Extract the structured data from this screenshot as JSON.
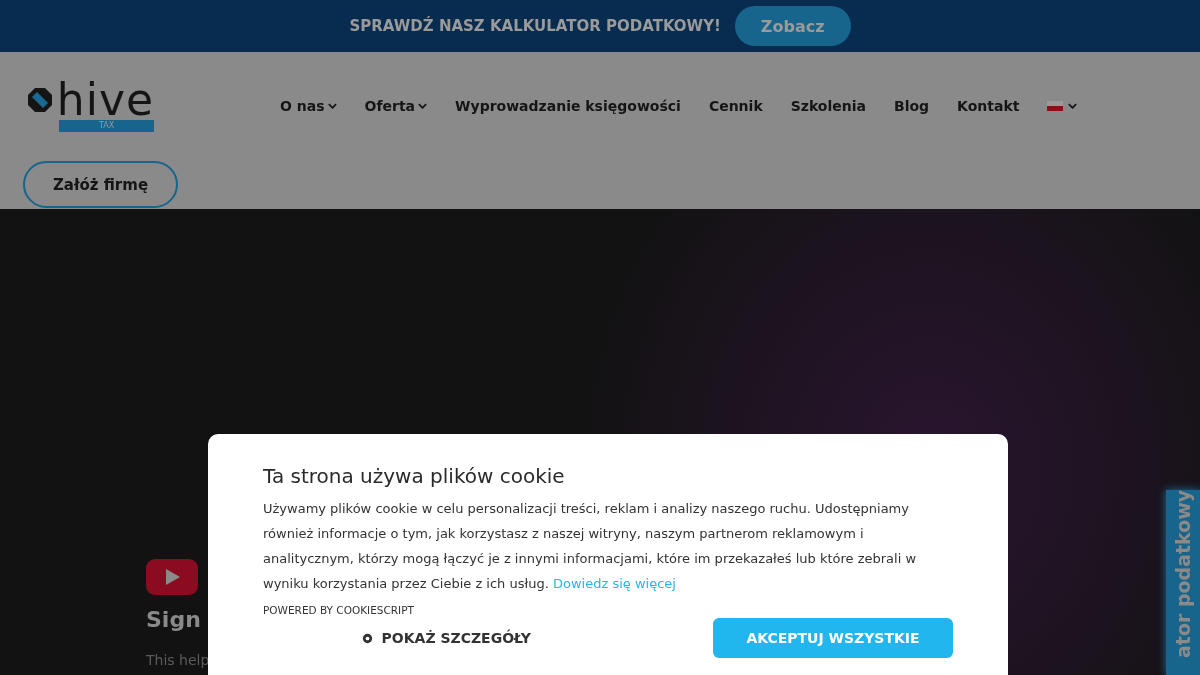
{
  "promo_bar": {
    "text": "SPRAWDŹ NASZ KALKULATOR PODATKOWY!",
    "button": "Zobacz"
  },
  "header": {
    "logo": {
      "name": "hive",
      "tag": "TAX"
    },
    "nav": [
      {
        "label": "O nas",
        "dropdown": true
      },
      {
        "label": "Oferta",
        "dropdown": true
      },
      {
        "label": "Wyprowadzanie księgowości",
        "dropdown": false
      },
      {
        "label": "Cennik",
        "dropdown": false
      },
      {
        "label": "Szkolenia",
        "dropdown": false
      },
      {
        "label": "Blog",
        "dropdown": false
      },
      {
        "label": "Kontakt",
        "dropdown": false
      }
    ],
    "cta": "Załóż firmę"
  },
  "video_embed": {
    "heading": "Sign",
    "text": "This help"
  },
  "side_tab": {
    "label": "ator podatkowy"
  },
  "cookie_modal": {
    "title": "Ta strona używa plików cookie",
    "body": "Używamy plików cookie w celu personalizacji treści, reklam i analizy naszego ruchu. Udostępniamy również informacje o tym, jak korzystasz z naszej witryny, naszym partnerom reklamowym i analitycznym, którzy mogą łączyć je z innymi informacjami, które im przekazałeś lub które zebrali w wyniku korzystania przez Ciebie z ich usług.",
    "link": "Dowiedz się więcej",
    "powered_by": "POWERED BY COOKIESCRIPT",
    "buttons": [
      {
        "label": "POKAŻ SZCZEGÓŁY",
        "kind": "details"
      },
      {
        "label": "AKCEPTUJ WSZYSTKIE",
        "kind": "accept"
      }
    ]
  }
}
